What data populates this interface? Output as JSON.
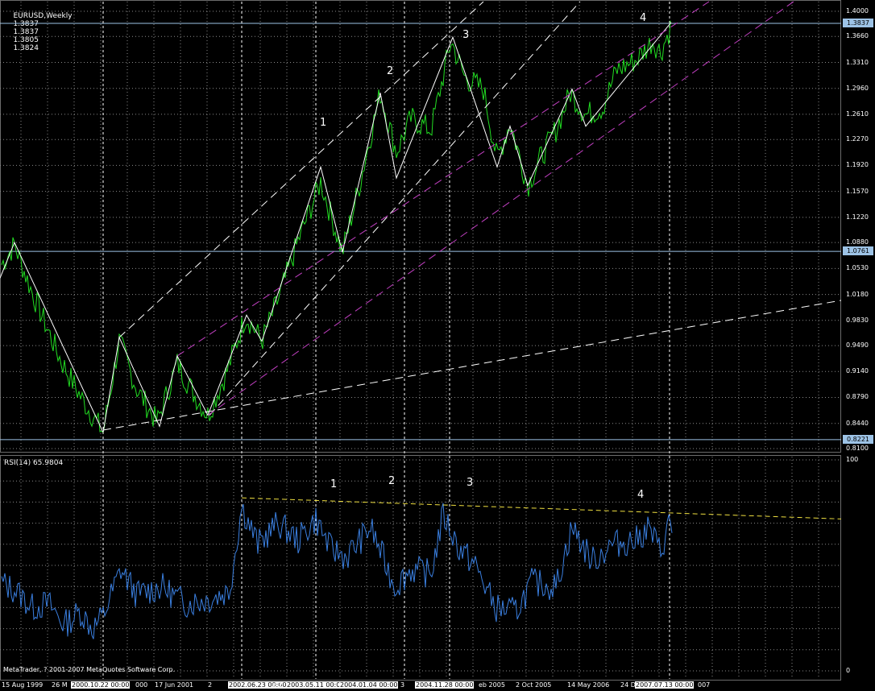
{
  "chart_header": {
    "symbol_tf": "EURUSD,Weekly",
    "ohlc": [
      "1.3837",
      "1.3837",
      "1.3805",
      "1.3824"
    ]
  },
  "rsi_header": {
    "label": "RSI(14) 65.9804"
  },
  "price_axis": {
    "ticks": [
      "1.4000",
      "1.3660",
      "1.3310",
      "1.2960",
      "1.2610",
      "1.2270",
      "1.1920",
      "1.1570",
      "1.1220",
      "1.0880",
      "1.0530",
      "1.0180",
      "0.9830",
      "0.9490",
      "0.9140",
      "0.8790",
      "0.8440",
      "0.8100"
    ],
    "tags": [
      "1.3837",
      "1.0761",
      "0.8221"
    ]
  },
  "rsi_axis": {
    "top": "100",
    "bottom": "0"
  },
  "time_axis": {
    "labels": [
      "15 Aug 1999",
      "26 M",
      "2000.10.22 00:00",
      "000",
      "17 Jun 2001",
      "2",
      "2002.06.23 00:00",
      "p 2",
      "2003.05.11 00:0",
      "2004.01.04 00:00",
      "3",
      "2004.11.28 00:00",
      "eb 2005",
      "2 Oct 2005",
      "14 May 2006",
      "24 D",
      "2007.07.13 00:00",
      "007"
    ]
  },
  "wave_labels": {
    "price": [
      "1",
      "2",
      "3",
      "4"
    ],
    "rsi": [
      "1",
      "2",
      "3",
      "4"
    ]
  },
  "footer": "MetaTrader, ? 2001-2007 MetaQuotes Software Corp.",
  "colors": {
    "price_line": "#22dd22",
    "rsi_line": "#3a7fe0",
    "zigzag": "#ffffff",
    "channel_dash": "#ffffff",
    "magenta_dash": "#c03fc0",
    "yellow_dash": "#f0e040",
    "grid": "#8a8a8a",
    "tag_bg": "#9dc3e6"
  },
  "chart_data": [
    {
      "type": "line",
      "title": "EURUSD,Weekly",
      "ylim": [
        0.81,
        1.4
      ],
      "grid": true,
      "series": [
        {
          "name": "EURUSD,Weekly",
          "x": [
            "1999-08-15",
            "1999-12-01",
            "2000-06-01",
            "2000-10-22",
            "2001-01-15",
            "2001-06-17",
            "2001-10-01",
            "2002-02-01",
            "2002-06-23",
            "2002-12-01",
            "2003-05-11",
            "2003-10-01",
            "2004-01-04",
            "2004-06-01",
            "2004-11-28",
            "2005-02-01",
            "2005-06-01",
            "2005-10-02",
            "2006-01-01",
            "2006-05-14",
            "2006-12-24",
            "2007-07-13"
          ],
          "values": [
            1.06,
            1.05,
            0.95,
            0.83,
            0.92,
            0.85,
            0.9,
            0.86,
            0.99,
            1.05,
            1.18,
            1.09,
            1.27,
            1.19,
            1.34,
            1.3,
            1.19,
            1.22,
            1.17,
            1.28,
            1.33,
            1.3824
          ]
        }
      ]
    },
    {
      "type": "line",
      "title": "RSI(14) 65.9804",
      "ylim": [
        0,
        100
      ],
      "grid": true,
      "series": [
        {
          "name": "RSI(14)",
          "x": [
            "1999-08-15",
            "2000-10-22",
            "2001-06-17",
            "2002-06-23",
            "2003-05-11",
            "2004-01-04",
            "2004-11-28",
            "2005-10-02",
            "2006-05-14",
            "2007-07-13"
          ],
          "values": [
            44,
            24,
            42,
            78,
            72,
            70,
            72,
            30,
            62,
            65.98
          ]
        }
      ]
    }
  ]
}
